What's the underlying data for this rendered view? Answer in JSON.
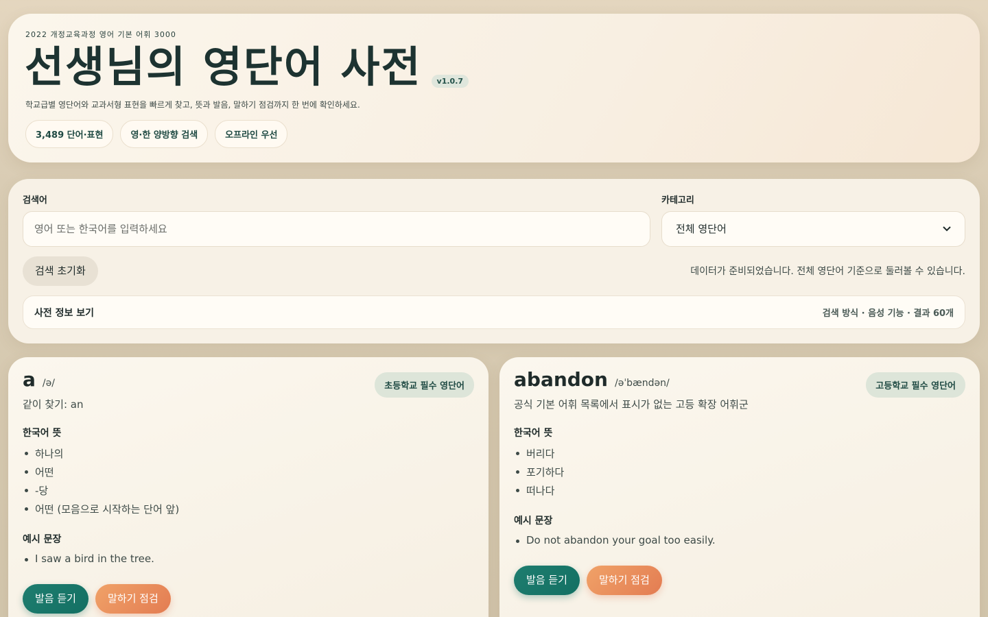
{
  "hero": {
    "eyebrow": "2022 개정교육과정 영어 기본 어휘 3000",
    "title": "선생님의 영단어 사전",
    "version": "v1.0.7",
    "subtitle": "학교급별 영단어와 교과서형 표현을 빠르게 찾고, 뜻과 발음, 말하기 점검까지 한 번에 확인하세요.",
    "chips": [
      "3,489 단어·표현",
      "영·한 양방향 검색",
      "오프라인 우선"
    ]
  },
  "search": {
    "query_label": "검색어",
    "placeholder": "영어 또는 한국어를 입력하세요",
    "category_label": "카테고리",
    "category_value": "전체 영단어",
    "reset_label": "검색 초기화",
    "status": "데이터가 준비되었습니다. 전체 영단어 기준으로 둘러볼 수 있습니다.",
    "info_title": "사전 정보 보기",
    "info_meta": "검색 방식 · 음성 기능 · 결과 60개"
  },
  "cards": [
    {
      "word": "a",
      "ipa": "/ə/",
      "badge": "초등학교 필수 영단어",
      "alt": "같이 찾기: an",
      "meaning_label": "한국어 뜻",
      "meanings": [
        "하나의",
        "어떤",
        "-당",
        "어떤 (모음으로 시작하는 단어 앞)"
      ],
      "example_label": "예시 문장",
      "examples": [
        "I saw a bird in the tree."
      ],
      "listen_label": "발음 듣기",
      "speak_label": "말하기 점검"
    },
    {
      "word": "abandon",
      "ipa": "/əˈbændən/",
      "badge": "고등학교 필수 영단어",
      "alt": "공식 기본 어휘 목록에서 표시가 없는 고등 확장 어휘군",
      "meaning_label": "한국어 뜻",
      "meanings": [
        "버리다",
        "포기하다",
        "떠나다"
      ],
      "example_label": "예시 문장",
      "examples": [
        "Do not abandon your goal too easily."
      ],
      "listen_label": "발음 듣기",
      "speak_label": "말하기 점검"
    }
  ]
}
